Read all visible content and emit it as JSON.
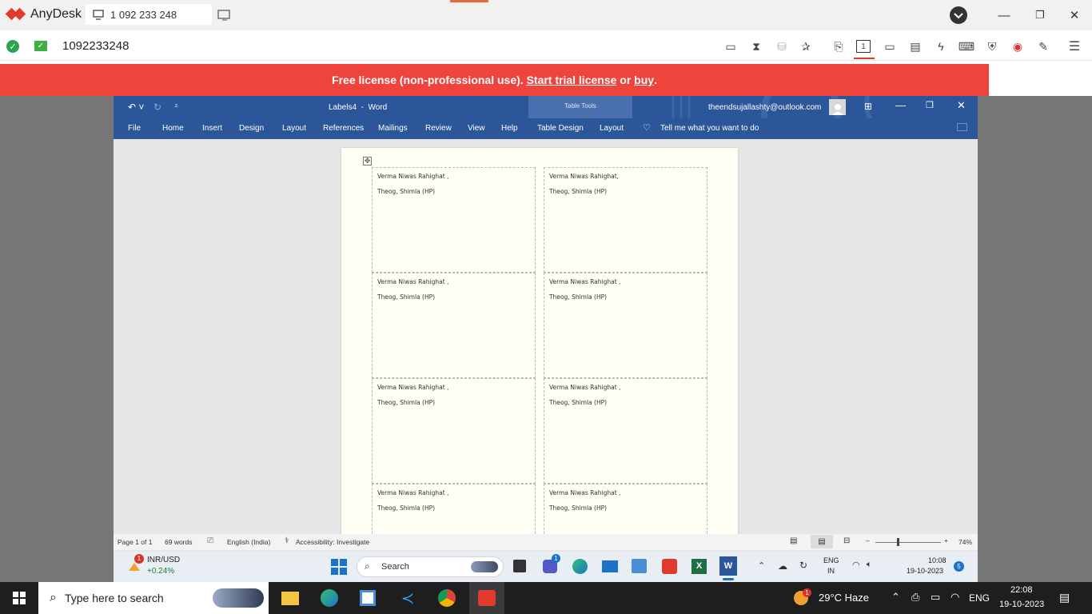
{
  "anydesk": {
    "app_name": "AnyDesk",
    "tab_label": "1 092 233 248",
    "address_id": "1092233248",
    "banner": {
      "prefix": "Free license (non-professional use).",
      "trial_link": "Start trial license",
      "or": "or",
      "buy_link": "buy",
      "suffix": "."
    }
  },
  "word": {
    "doc_title": "Labels4",
    "app": "Word",
    "separator": "-",
    "table_tools": "Table Tools",
    "account": "theendsujallashty@outlook.com",
    "ribbon_tabs": [
      "File",
      "Home",
      "Insert",
      "Design",
      "Layout",
      "References",
      "Mailings",
      "Review",
      "View",
      "Help",
      "Table Design",
      "Layout"
    ],
    "tell_me": "Tell me what you want to do",
    "labels": [
      {
        "line1": "Verma Niwas Rahighat ,",
        "line2": "Theog, Shimla (HP)"
      },
      {
        "line1": "Verma Niwas Rahighat,",
        "line2": "Theog, Shimla (HP)"
      },
      {
        "line1": "Verma Niwas Rahighat ,",
        "line2": "Theog, Shimla (HP)"
      },
      {
        "line1": "Verma Niwas Rahighat ,",
        "line2": "Theog, Shimla (HP)"
      },
      {
        "line1": "Verma Niwas Rahighat ,",
        "line2": "Theog, Shimla (HP)"
      },
      {
        "line1": "Verma Niwas Rahighat ,",
        "line2": "Theog, Shimla (HP)"
      },
      {
        "line1": "Verma Niwas Rahighat ,",
        "line2": "Theog, Shimla (HP)"
      },
      {
        "line1": "Verma Niwas Rahighat ,",
        "line2": "Theog, Shimla (HP)"
      }
    ],
    "status": {
      "page": "Page 1 of 1",
      "words": "69 words",
      "language": "English (India)",
      "accessibility": "Accessibility: Investigate",
      "zoom": "74%"
    }
  },
  "remote_taskbar": {
    "ticker_name": "INR/USD",
    "ticker_change": "+0.24%",
    "ticker_badge": "1",
    "search": "Search",
    "lang_top": "ENG",
    "lang_bottom": "IN",
    "time": "10:08",
    "date": "19-10-2023",
    "notif_count": "5",
    "teams_badge": "1"
  },
  "taskbar": {
    "search_placeholder": "Type here to search",
    "weather": "29°C  Haze",
    "weather_badge": "1",
    "lang": "ENG",
    "time": "22:08",
    "date": "19-10-2023"
  }
}
